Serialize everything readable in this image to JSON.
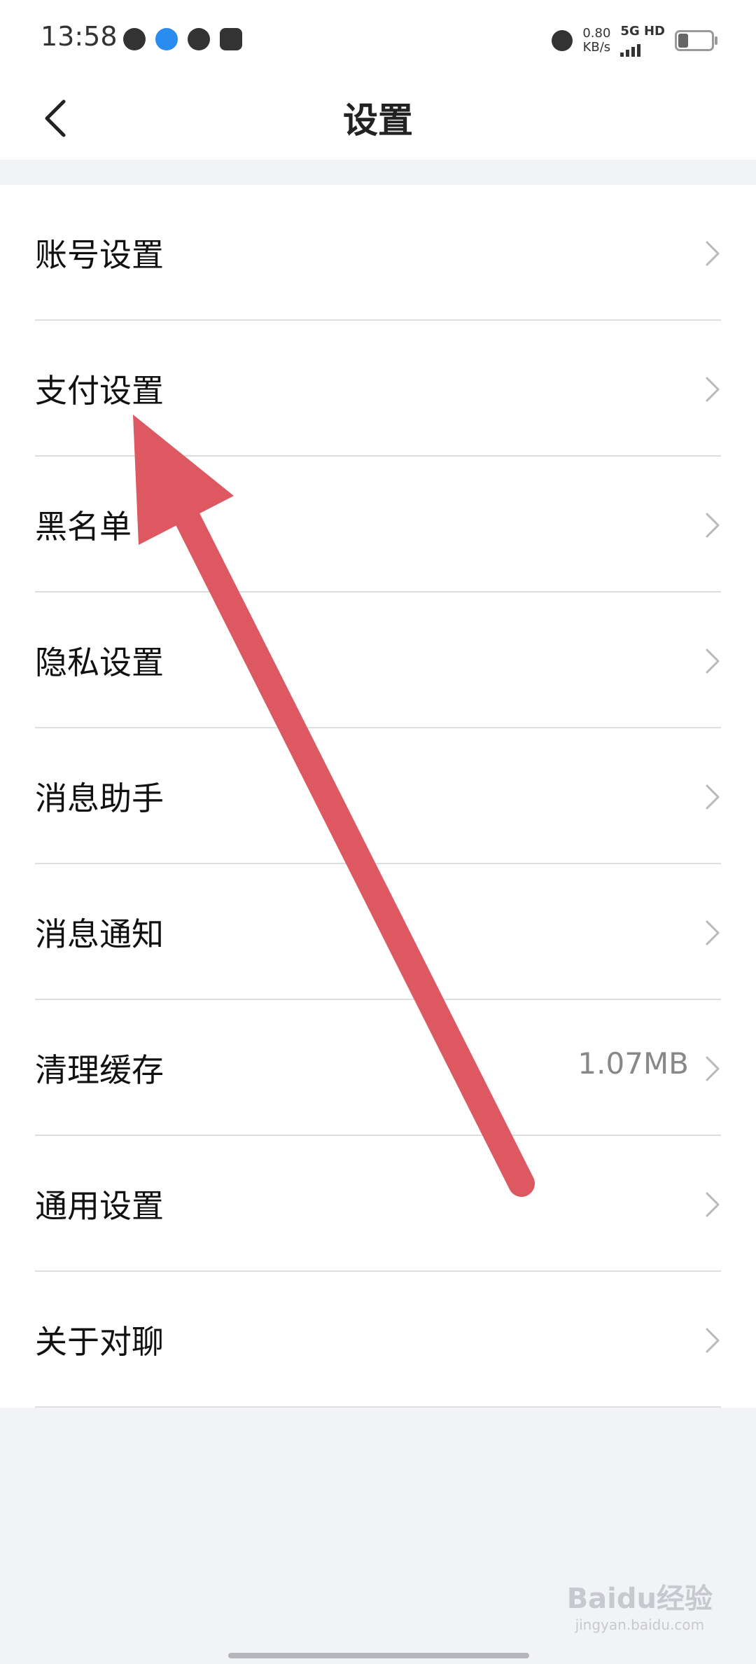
{
  "status": {
    "time": "13:58",
    "speed_value": "0.80",
    "speed_unit": "KB/s",
    "network": "5G HD"
  },
  "header": {
    "title": "设置"
  },
  "settings_items": [
    {
      "label": "账号设置",
      "value": ""
    },
    {
      "label": "支付设置",
      "value": ""
    },
    {
      "label": "黑名单",
      "value": ""
    },
    {
      "label": "隐私设置",
      "value": ""
    },
    {
      "label": "消息助手",
      "value": ""
    },
    {
      "label": "消息通知",
      "value": ""
    },
    {
      "label": "清理缓存",
      "value": "1.07MB"
    },
    {
      "label": "通用设置",
      "value": ""
    },
    {
      "label": "关于对聊",
      "value": ""
    }
  ],
  "watermark": {
    "text": "Baidu经验",
    "subtext": "jingyan.baidu.com"
  },
  "colors": {
    "annotation_arrow": "#dd5860",
    "background": "#f2f3f7"
  }
}
